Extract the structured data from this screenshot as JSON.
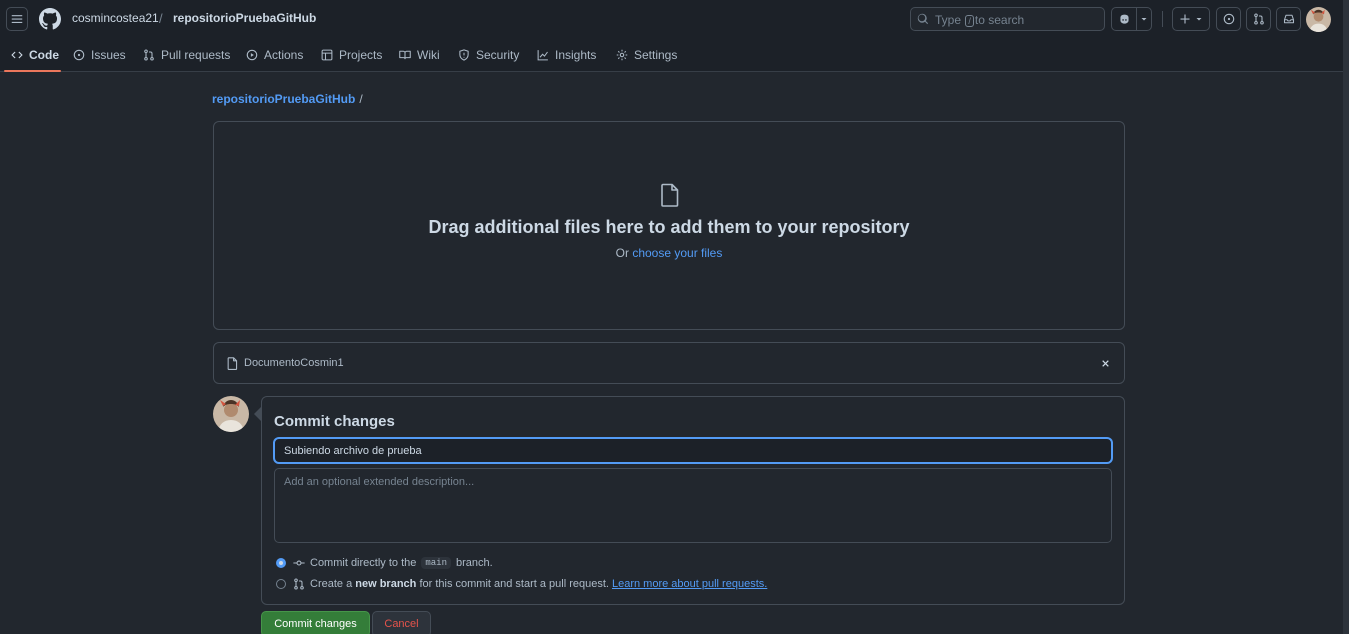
{
  "header": {
    "owner": "cosmincostea21",
    "separator": "/",
    "repo": "repositorioPruebaGitHub",
    "search": {
      "prefix": "Type",
      "key": "/",
      "suffix": "to search"
    },
    "icons": [
      "hamburger-menu-icon",
      "github-logo-icon",
      "search-icon",
      "copilot-icon",
      "chevron-down-icon",
      "plus-icon",
      "issues-icon",
      "pull-requests-icon",
      "inbox-icon",
      "avatar"
    ]
  },
  "tabs": [
    {
      "label": "Code",
      "icon": "code-icon",
      "active": true
    },
    {
      "label": "Issues",
      "icon": "issue-opened-icon"
    },
    {
      "label": "Pull requests",
      "icon": "git-pull-request-icon"
    },
    {
      "label": "Actions",
      "icon": "play-icon"
    },
    {
      "label": "Projects",
      "icon": "table-icon"
    },
    {
      "label": "Wiki",
      "icon": "book-icon"
    },
    {
      "label": "Security",
      "icon": "shield-icon"
    },
    {
      "label": "Insights",
      "icon": "graph-icon"
    },
    {
      "label": "Settings",
      "icon": "gear-icon"
    }
  ],
  "breadcrumb": {
    "repo": "repositorioPruebaGitHub",
    "slash": "/"
  },
  "dropzone": {
    "title": "Drag additional files here to add them to your repository",
    "prefix": "Or",
    "link": "choose your files"
  },
  "file": {
    "name": "DocumentoCosmin1"
  },
  "commit": {
    "title": "Commit changes",
    "summary_value": "Subiendo archivo de prueba",
    "description_placeholder": "Add an optional extended description...",
    "option_direct": {
      "before": "Commit directly to the",
      "branch": "main",
      "after": "branch.",
      "selected": true
    },
    "option_new": {
      "before": "Create a",
      "bold": "new branch",
      "after": "for this commit and start a pull request.",
      "link": "Learn more about pull requests.",
      "selected": false
    },
    "submit_label": "Commit changes",
    "cancel_label": "Cancel"
  },
  "colors": {
    "background": "#22272e",
    "header": "#1c2128",
    "accent_link": "#539bf5",
    "tab_underline": "#ec775c",
    "primary_button": "#347d39",
    "danger_text": "#e5534b"
  }
}
